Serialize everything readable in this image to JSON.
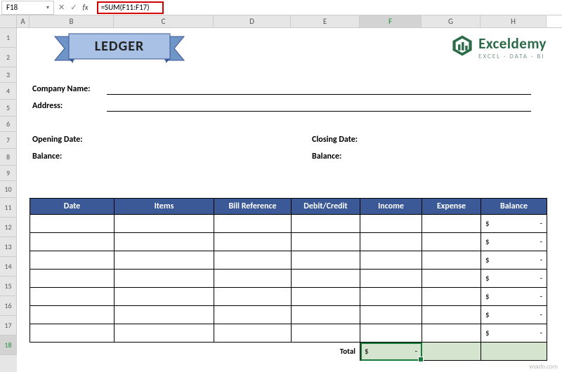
{
  "formula_bar": {
    "cell_ref": "F18",
    "fx_label": "fx",
    "formula": "=SUM(F11:F17)"
  },
  "columns": [
    "A",
    "B",
    "C",
    "D",
    "E",
    "F",
    "G",
    "H"
  ],
  "rows": [
    "1",
    "2",
    "3",
    "4",
    "5",
    "6",
    "7",
    "8",
    "9",
    "10",
    "11",
    "12",
    "13",
    "14",
    "15",
    "16",
    "17",
    "18"
  ],
  "active_col": "F",
  "active_row": "18",
  "banner_title": "LEDGER",
  "logo": {
    "brand": "Exceldemy",
    "sub": "EXCEL · DATA · BI"
  },
  "labels": {
    "company_name": "Company Name:",
    "address": "Address:",
    "opening_date": "Opening Date:",
    "closing_date": "Closing Date:",
    "balance_left": "Balance:",
    "balance_right": "Balance:"
  },
  "table": {
    "headers": [
      "Date",
      "Items",
      "Bill Reference",
      "Debit/Credit",
      "Income",
      "Expense",
      "Balance"
    ],
    "balance_placeholder": "$        -",
    "total_label": "Total",
    "total_income": "$         -"
  },
  "chart_data": {
    "type": "table",
    "title": "LEDGER",
    "columns": [
      "Date",
      "Items",
      "Bill Reference",
      "Debit/Credit",
      "Income",
      "Expense",
      "Balance"
    ],
    "rows": [
      {
        "Date": "",
        "Items": "",
        "Bill Reference": "",
        "Debit/Credit": "",
        "Income": "",
        "Expense": "",
        "Balance": "$ -"
      },
      {
        "Date": "",
        "Items": "",
        "Bill Reference": "",
        "Debit/Credit": "",
        "Income": "",
        "Expense": "",
        "Balance": "$ -"
      },
      {
        "Date": "",
        "Items": "",
        "Bill Reference": "",
        "Debit/Credit": "",
        "Income": "",
        "Expense": "",
        "Balance": "$ -"
      },
      {
        "Date": "",
        "Items": "",
        "Bill Reference": "",
        "Debit/Credit": "",
        "Income": "",
        "Expense": "",
        "Balance": "$ -"
      },
      {
        "Date": "",
        "Items": "",
        "Bill Reference": "",
        "Debit/Credit": "",
        "Income": "",
        "Expense": "",
        "Balance": "$ -"
      },
      {
        "Date": "",
        "Items": "",
        "Bill Reference": "",
        "Debit/Credit": "",
        "Income": "",
        "Expense": "",
        "Balance": "$ -"
      },
      {
        "Date": "",
        "Items": "",
        "Bill Reference": "",
        "Debit/Credit": "",
        "Income": "",
        "Expense": "",
        "Balance": "$ -"
      }
    ],
    "totals": {
      "Income": "$ -",
      "Expense": "",
      "Balance": ""
    }
  },
  "watermark": "wsxdn.com"
}
